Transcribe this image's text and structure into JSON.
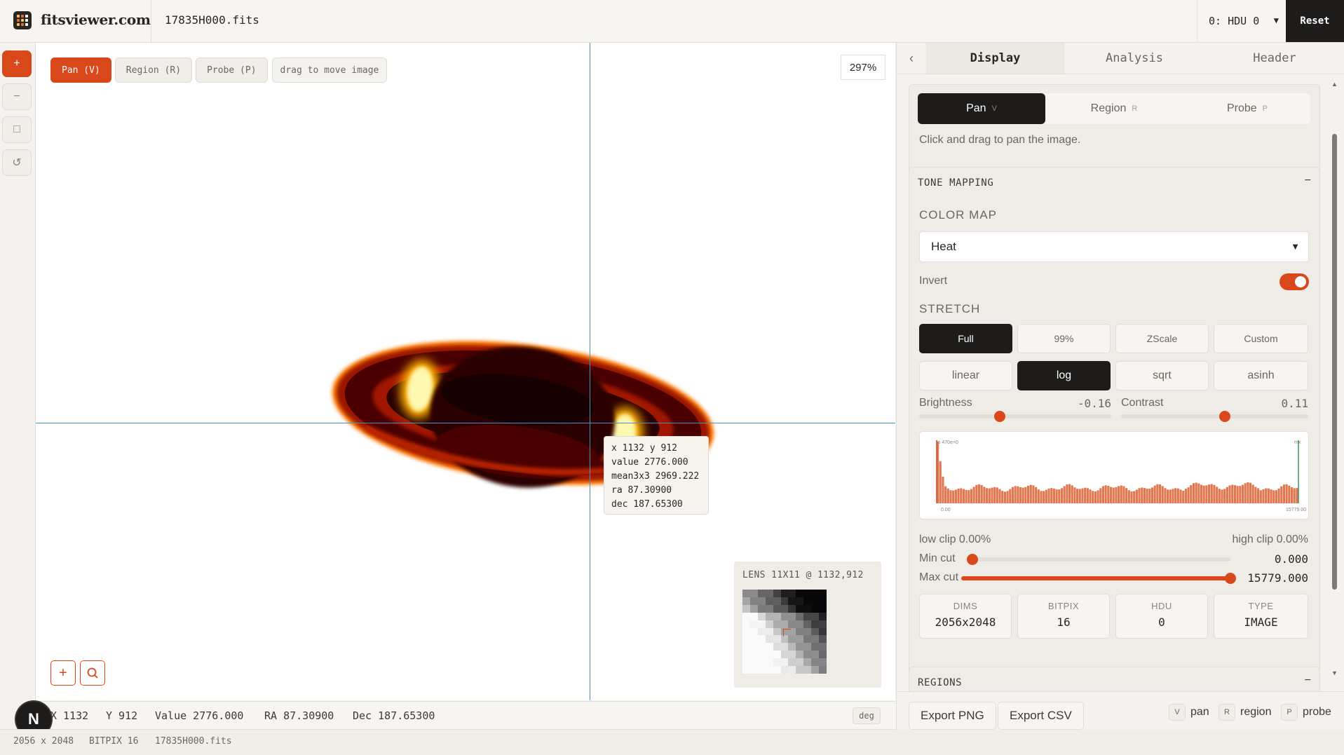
{
  "header": {
    "brand": "fitsviewer.com",
    "file_name": "17835H000.fits",
    "hdu_selected": "0: HDU 0",
    "reset_label": "Reset"
  },
  "tools": [
    {
      "name": "zoom-in",
      "glyph": "+"
    },
    {
      "name": "zoom-out",
      "glyph": "−"
    },
    {
      "name": "fit",
      "glyph": "□"
    },
    {
      "name": "rotate",
      "glyph": "↺"
    }
  ],
  "viewer": {
    "modes": [
      {
        "label": "Pan (V)",
        "active": true
      },
      {
        "label": "Region (R)",
        "active": false
      },
      {
        "label": "Probe (P)",
        "active": false
      }
    ],
    "mode_hint": "drag to move image",
    "zoom": "297%",
    "probe": {
      "line1": "x 1132 y 912",
      "line2": "value 2776.000",
      "line3": "mean3x3 2969.222",
      "line4": "ra 87.30900",
      "line5": "dec 187.65300"
    },
    "lens_title": "LENS 11X11 @ 1132,912"
  },
  "statusbar": {
    "x": "X 1132",
    "y": "Y 912",
    "value": "Value 2776.000",
    "ra": "RA 87.30900",
    "dec": "Dec 187.65300",
    "unit": "deg",
    "n_badge": "N"
  },
  "footer": {
    "dims": "2056 x 2048",
    "bitpix": "BITPIX 16",
    "file": "17835H000.fits"
  },
  "panel": {
    "tabs": [
      "Display",
      "Analysis",
      "Header"
    ],
    "active_tab": "Display",
    "interaction": {
      "modes": [
        {
          "label": "Pan",
          "key": "V",
          "active": true
        },
        {
          "label": "Region",
          "key": "R",
          "active": false
        },
        {
          "label": "Probe",
          "key": "P",
          "active": false
        }
      ],
      "hint": "Click and drag to pan the image."
    },
    "tone": {
      "title": "TONE MAPPING",
      "toggle": "−",
      "colormap_label": "COLOR MAP",
      "colormap_value": "Heat",
      "invert_label": "Invert",
      "invert_on": true,
      "stretch_label": "STRETCH",
      "ranges": [
        {
          "label": "Full",
          "active": true
        },
        {
          "label": "99%",
          "active": false
        },
        {
          "label": "ZScale",
          "active": false
        },
        {
          "label": "Custom",
          "active": false
        }
      ],
      "scales": [
        {
          "label": "linear",
          "active": false
        },
        {
          "label": "log",
          "active": true
        },
        {
          "label": "sqrt",
          "active": false
        },
        {
          "label": "asinh",
          "active": false
        }
      ],
      "brightness_label": "Brightness",
      "brightness_value": "-0.16",
      "brightness": -0.16,
      "contrast_label": "Contrast",
      "contrast_value": "0.11",
      "contrast": 0.11,
      "histogram": {
        "min_tick": "0.00",
        "max_tick": "15779.00",
        "low_label": "lo 470e+0",
        "high_label": "mx"
      },
      "low_clip": "low clip 0.00%",
      "high_clip": "high clip 0.00%",
      "min_cut_label": "Min cut",
      "min_cut_value": "0.000",
      "max_cut_label": "Max cut",
      "max_cut_value": "15779.000"
    },
    "stats": [
      {
        "k": "DIMS",
        "v": "2056x2048"
      },
      {
        "k": "BITPIX",
        "v": "16"
      },
      {
        "k": "HDU",
        "v": "0"
      },
      {
        "k": "TYPE",
        "v": "IMAGE"
      }
    ],
    "regions_title": "REGIONS",
    "regions_toggle": "−",
    "footer": {
      "export_png": "Export PNG",
      "export_csv": "Export CSV",
      "shortcuts": [
        {
          "key": "V",
          "label": "pan"
        },
        {
          "key": "R",
          "label": "region"
        },
        {
          "key": "P",
          "label": "probe"
        }
      ]
    }
  },
  "colors": {
    "accent": "#d9481a",
    "dark": "#1e1c1a",
    "crosshair": "#4a90c2"
  }
}
